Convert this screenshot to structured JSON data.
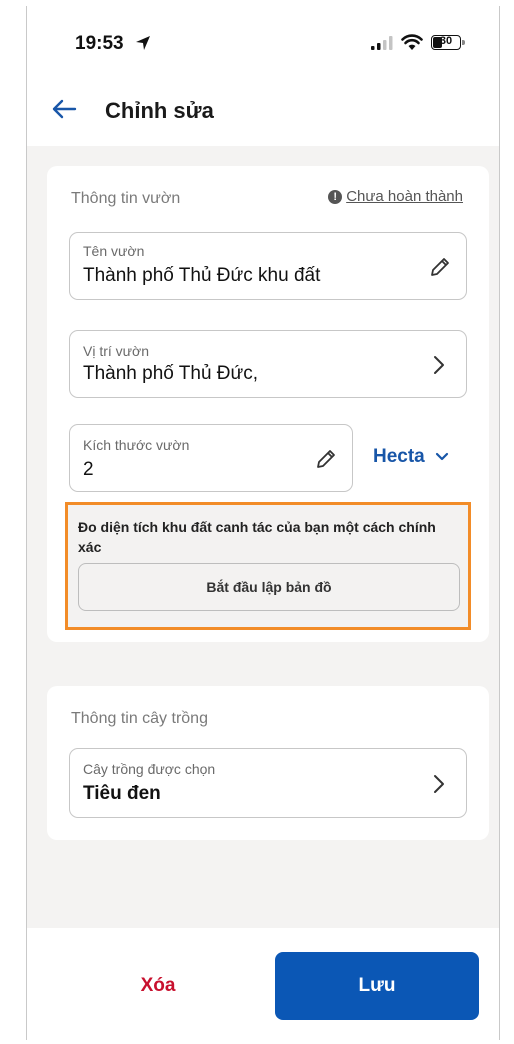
{
  "status_bar": {
    "time": "19:53",
    "battery": "30"
  },
  "header": {
    "title": "Chỉnh sửa"
  },
  "garden_info": {
    "section_label": "Thông tin vườn",
    "status_link": "Chưa hoàn thành",
    "name_field": {
      "label": "Tên vườn",
      "value": "Thành phố Thủ Đức khu đất"
    },
    "location_field": {
      "label": "Vị trí vườn",
      "value": "Thành phố Thủ Đức,"
    },
    "size_field": {
      "label": "Kích thước vườn",
      "value": "2"
    },
    "unit_select": {
      "value": "Hecta"
    },
    "mapping": {
      "text": "Đo diện tích khu đất canh tác của bạn một cách chính xác",
      "button_label": "Bắt đầu lập bản đồ"
    }
  },
  "crop_info": {
    "section_label": "Thông tin cây trồng",
    "crop_field": {
      "label": "Cây trồng được chọn",
      "value": "Tiêu đen"
    }
  },
  "footer": {
    "delete_label": "Xóa",
    "save_label": "Lưu"
  },
  "colors": {
    "accent": "#0b57b5",
    "danger": "#c8102e",
    "highlight_border": "#f28c28"
  }
}
